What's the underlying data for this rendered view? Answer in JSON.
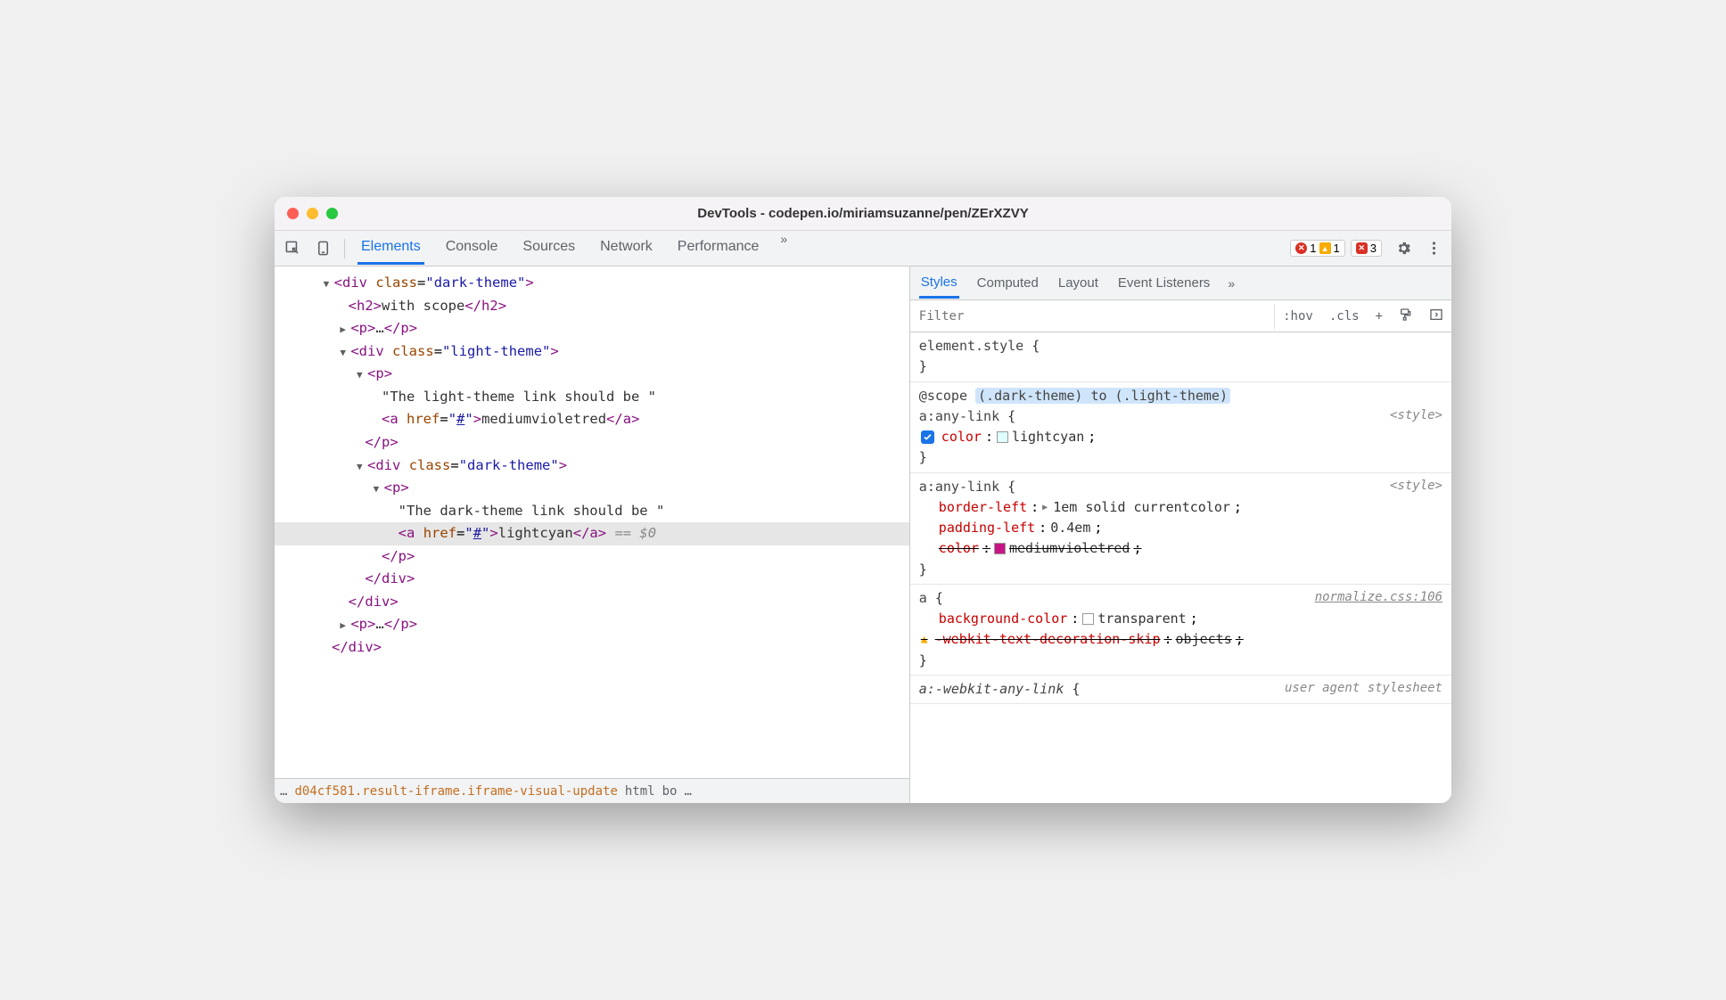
{
  "window": {
    "title": "DevTools - codepen.io/miriamsuzanne/pen/ZErXZVY"
  },
  "tabs": {
    "items": [
      "Elements",
      "Console",
      "Sources",
      "Network",
      "Performance"
    ],
    "active": "Elements"
  },
  "badges": {
    "errors": "1",
    "warnings": "1",
    "messages": "3"
  },
  "dom": {
    "line1_tag": "div",
    "line1_class": "dark-theme",
    "line2_tag": "h2",
    "line2_text": "with scope",
    "line3_tag": "p",
    "line3_ell": "…",
    "line4_tag": "div",
    "line4_class": "light-theme",
    "line5_tag": "p",
    "line6_text": "\"The light-theme link should be \"",
    "line7_tag": "a",
    "line7_attr": "href",
    "line7_href": "#",
    "line7_text": "mediumvioletred",
    "line8_close_p": "p",
    "line9_tag": "div",
    "line9_class": "dark-theme",
    "line10_tag": "p",
    "line11_text": "\"The dark-theme link should be \"",
    "line12_tag": "a",
    "line12_attr": "href",
    "line12_href": "#",
    "line12_text": "lightcyan",
    "line12_hint": "== $0",
    "line13_close_p": "p",
    "line14_close_div": "div",
    "line15_close_div": "div",
    "line16_tag": "p",
    "line16_ell": "…",
    "line17_close_div": "div"
  },
  "breadcrumb": {
    "ell": "…",
    "item1": "d04cf581.result-iframe.iframe-visual-update",
    "item2": "html",
    "item3": "bo",
    "ell2": "…"
  },
  "styles_tabs": {
    "items": [
      "Styles",
      "Computed",
      "Layout",
      "Event Listeners"
    ],
    "active": "Styles"
  },
  "filter": {
    "placeholder": "Filter"
  },
  "toolbar_btns": {
    "hov": ":hov",
    "cls": ".cls"
  },
  "rules": {
    "r0": {
      "selector": "element.style",
      "open": "{",
      "close": "}"
    },
    "r1": {
      "scope_kw": "@scope",
      "scope_text": "(.dark-theme) to (.light-theme)",
      "selector": "a:any-link",
      "open": "{",
      "close": "}",
      "src": "<style>",
      "prop1": "color",
      "val1": "lightcyan",
      "swatch1": "#e0ffff"
    },
    "r2": {
      "selector": "a:any-link",
      "open": "{",
      "close": "}",
      "src": "<style>",
      "prop1": "border-left",
      "val1": "1em solid currentcolor",
      "prop2": "padding-left",
      "val2": "0.4em",
      "prop3": "color",
      "val3": "mediumvioletred",
      "swatch3": "#c71585"
    },
    "r3": {
      "selector": "a",
      "open": "{",
      "close": "}",
      "src": "normalize.css:106",
      "prop1": "background-color",
      "val1": "transparent",
      "swatch1": "#ffffff",
      "prop2": "-webkit-text-decoration-skip",
      "val2": "objects"
    },
    "r4": {
      "selector": "a:-webkit-any-link",
      "open": "{",
      "src": "user agent stylesheet"
    }
  }
}
